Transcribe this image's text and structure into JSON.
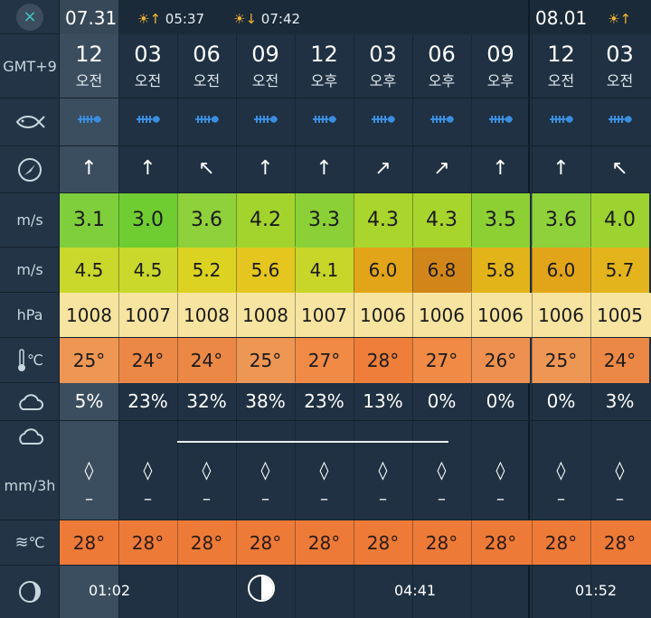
{
  "sidebar": {
    "close": "×",
    "timezone": "GMT+9",
    "wind_unit": "m/s",
    "gust_unit": "m/s",
    "pressure_unit": "hPa",
    "temp_unit": "℃",
    "precip_unit": "mm/3h",
    "sea_temp_unit": "℃"
  },
  "days": [
    {
      "date": "07.31",
      "sunrise": "05:37",
      "sunset": "07:42"
    },
    {
      "date": "08.01"
    }
  ],
  "hours": [
    {
      "h": "12",
      "ampm": "오전"
    },
    {
      "h": "03",
      "ampm": "오전"
    },
    {
      "h": "06",
      "ampm": "오전"
    },
    {
      "h": "09",
      "ampm": "오전"
    },
    {
      "h": "12",
      "ampm": "오후"
    },
    {
      "h": "03",
      "ampm": "오후"
    },
    {
      "h": "06",
      "ampm": "오후"
    },
    {
      "h": "09",
      "ampm": "오후"
    },
    {
      "h": "12",
      "ampm": "오전"
    },
    {
      "h": "03",
      "ampm": "오전"
    }
  ],
  "wind_dir": [
    "↑",
    "↑",
    "↖",
    "↑",
    "↑",
    "↗",
    "↗",
    "↑",
    "↑",
    "↖"
  ],
  "wind": [
    "3.1",
    "3.0",
    "3.6",
    "4.2",
    "3.3",
    "4.3",
    "4.3",
    "3.5",
    "3.6",
    "4.0"
  ],
  "gust": [
    "4.5",
    "4.5",
    "5.2",
    "5.6",
    "4.1",
    "6.0",
    "6.8",
    "5.8",
    "6.0",
    "5.7"
  ],
  "pressure": [
    "1008",
    "1007",
    "1008",
    "1008",
    "1007",
    "1006",
    "1006",
    "1006",
    "1006",
    "1005"
  ],
  "temp": [
    "25°",
    "24°",
    "24°",
    "25°",
    "27°",
    "28°",
    "27°",
    "26°",
    "25°",
    "24°"
  ],
  "cloud": [
    "5%",
    "23%",
    "32%",
    "38%",
    "23%",
    "13%",
    "0%",
    "0%",
    "0%",
    "3%"
  ],
  "precip": [
    "–",
    "–",
    "–",
    "–",
    "–",
    "–",
    "–",
    "–",
    "–",
    "–"
  ],
  "sea_temp": [
    "28°",
    "28°",
    "28°",
    "28°",
    "28°",
    "28°",
    "28°",
    "28°",
    "28°",
    "28°"
  ],
  "moon": {
    "times": [
      "01:02",
      "04:41",
      "01:52"
    ]
  },
  "colors": {
    "wind_band": [
      "#7fce3c",
      "#6fcd31",
      "#8fd13a",
      "#a3d42e",
      "#8bd036",
      "#a9d52c",
      "#a8d52c",
      "#8dd034",
      "#8fd13a",
      "#9dd330"
    ],
    "gust_band": [
      "#c9d82a",
      "#c9d82a",
      "#dcd221",
      "#e4c61e",
      "#c8d62a",
      "#e2a418",
      "#d2861a",
      "#e3b31a",
      "#e2a418",
      "#e3b41b"
    ],
    "pressure_bg": "#f6e4a0",
    "temp_band": [
      "#ee9654",
      "#ec8845",
      "#ec8845",
      "#ee9654",
      "#f08a44",
      "#ee7e3a",
      "#f08a44",
      "#ee9050",
      "#ee9654",
      "#ec8845"
    ],
    "sea_band": "#ee7a38",
    "fish_icon": "#3a8ee0",
    "sun_icon": "#f2b531"
  }
}
